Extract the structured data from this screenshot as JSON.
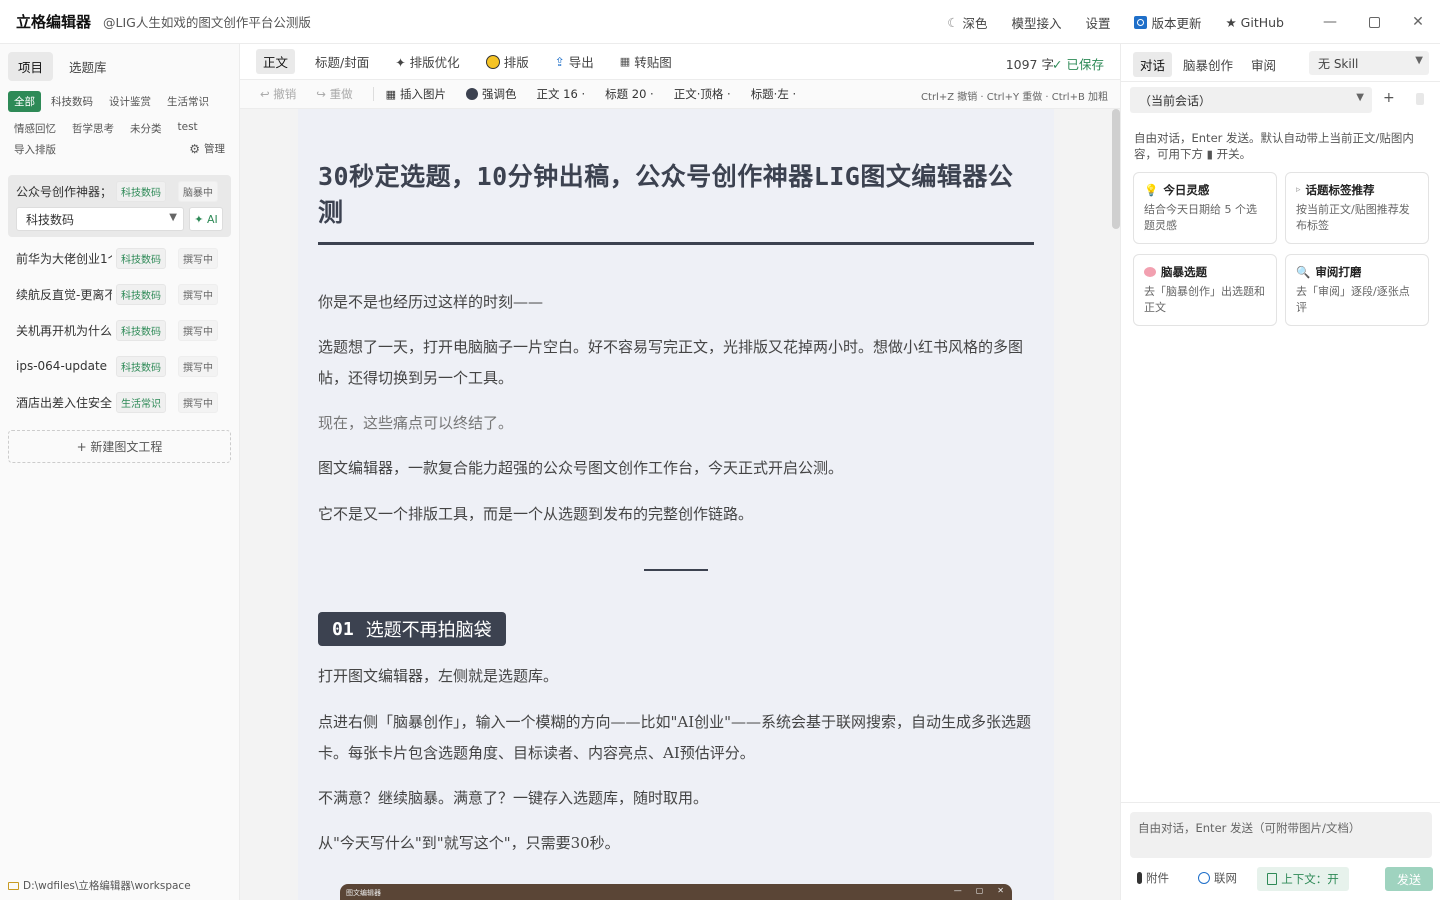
{
  "app": {
    "title": "立格编辑器",
    "subtitle": "@LIG人生如戏的图文创作平台公测版"
  },
  "titlebar": {
    "dark": "深色",
    "model": "模型接入",
    "settings": "设置",
    "update": "版本更新",
    "github": "★ GitHub"
  },
  "left": {
    "tabs": [
      "项目",
      "选题库"
    ],
    "filters": [
      "全部",
      "科技数码",
      "设计鉴赏",
      "生活常识",
      "情感回忆",
      "哲学思考",
      "未分类",
      "test"
    ],
    "import": "导入排版",
    "manage": "管理",
    "active_project": {
      "name": "公众号创作神器；",
      "tag": "科技数码",
      "status": "脑暴中",
      "category_select": "科技数码",
      "ai_button": "✦ AI"
    },
    "projects": [
      {
        "name": "前华为大佬创业1个",
        "tag": "科技数码",
        "status": "撰写中"
      },
      {
        "name": "续航反直觉-更离不",
        "tag": "科技数码",
        "status": "撰写中"
      },
      {
        "name": "关机再开机为什么",
        "tag": "科技数码",
        "status": "撰写中"
      },
      {
        "name": "ips-064-update",
        "tag": "科技数码",
        "status": "撰写中"
      },
      {
        "name": "酒店出差入住安全",
        "tag": "生活常识",
        "status": "撰写中"
      }
    ],
    "new_project": "+ 新建图文工程",
    "workspace_path": "D:\\wdfiles\\立格编辑器\\workspace"
  },
  "toolbar1": {
    "items": [
      "正文",
      "标题/封面",
      "✦ 排版优化",
      "排版",
      "导出",
      "转贴图"
    ],
    "word_count": "1097 字",
    "saved": "✓ 已保存"
  },
  "toolbar2": {
    "undo": "↩ 撤销",
    "redo": "↪ 重做",
    "insert_image": "插入图片",
    "accent": "强调色",
    "body_font": "正文 16 ·",
    "heading_font": "标题 20 ·",
    "body_align": "正文·顶格 ·",
    "heading_align": "标题·左 ·",
    "shortcuts": "Ctrl+Z 撤销 · Ctrl+Y 重做 · Ctrl+B 加粗"
  },
  "doc": {
    "title": "30秒定选题，10分钟出稿，公众号创作神器LIG图文编辑器公测",
    "p1": "你是不是也经历过这样的时刻——",
    "p2": "选题想了一天，打开电脑脑子一片空白。好不容易写完正文，光排版又花掉两小时。想做小红书风格的多图帖，还得切换到另一个工具。",
    "p3": "现在，这些痛点可以终结了。",
    "p4": "图文编辑器，一款复合能力超强的公众号图文创作工作台，今天正式开启公测。",
    "p5": "它不是又一个排版工具，而是一个从选题到发布的完整创作链路。",
    "section_num": "01",
    "section_title": "选题不再拍脑袋",
    "p6": "打开图文编辑器，左侧就是选题库。",
    "p7": "点进右侧「脑暴创作」，输入一个模糊的方向——比如\"AI创业\"——系统会基于联网搜索，自动生成多张选题卡。每张卡片包含选题角度、目标读者、内容亮点、AI预估评分。",
    "p8": "不满意？继续脑暴。满意了？一键存入选题库，随时取用。",
    "p9": "从\"今天写什么\"到\"就写这个\"，只需要30秒。",
    "embed_title": "图文编辑器"
  },
  "right": {
    "tabs": [
      "对话",
      "脑暴创作",
      "审阅"
    ],
    "skill": "无 Skill",
    "session": "（当前会话）",
    "hint": "自由对话，Enter 发送。默认自动带上当前正文/贴图内容，可用下方 ▮ 开关。",
    "cards": [
      {
        "title": "今日灵感",
        "desc": "结合今天日期给 5 个选题灵感"
      },
      {
        "title": "话题标签推荐",
        "desc": "按当前正文/贴图推荐发布标签"
      },
      {
        "title": "脑暴选题",
        "desc": "去「脑暴创作」出选题和正文"
      },
      {
        "title": "审阅打磨",
        "desc": "去「审阅」逐段/逐张点评"
      }
    ],
    "input_placeholder": "自由对话，Enter 发送（可附带图片/文档）",
    "attach": "附件",
    "web": "联网",
    "context": "上下文：开",
    "send": "发送"
  },
  "colors": {
    "accent": "#2e8a57",
    "heading_dark": "#3c4250",
    "paper": "#eef0f6"
  }
}
